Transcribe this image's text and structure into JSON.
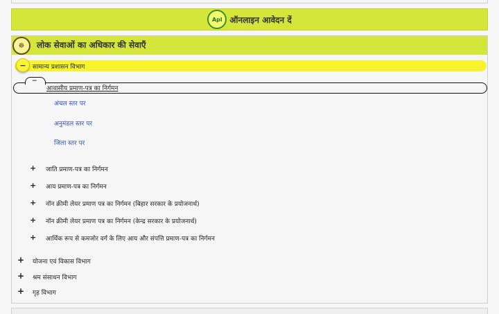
{
  "online_bar": {
    "logo_text": "Apl",
    "title": "ऑनलाइन आवेदन दें"
  },
  "panel": {
    "title": "लोक सेवाओं का अधिकार की सेवाएँ",
    "expanded_department": {
      "toggle": "−",
      "label": "सामान्य प्रशासन विभाग"
    },
    "expanded_service": {
      "toggle": "−",
      "label": "आवासीय प्रमाण-पत्र का निर्गमन"
    },
    "service_levels": [
      "अंचल स्तर पर",
      "अनुमंडल स्तर पर",
      "जिला स्तर पर"
    ],
    "services": [
      "जाति प्रमाण-पत्र का निर्गमन",
      "आय प्रमाण-पत्र का निर्गमन",
      "नॉन क्रीमी लेयर प्रमाण पत्र का निर्गमन (बिहार सरकार के प्रयोजनार्थ)",
      "नॉन क्रीमी लेयर प्रमाण पत्र का निर्गमन (केन्द्र सरकार के प्रयोजनार्थ)",
      "आर्थिक रूप से कमजोर वर्ग के लिए आय और संपत्ति प्रमाण-पत्र का निर्गमन"
    ],
    "departments": [
      "योजना एवं विकास विभाग",
      "श्रम संसाधन विभाग",
      "गृह विभाग"
    ],
    "expand_symbol": "+"
  }
}
